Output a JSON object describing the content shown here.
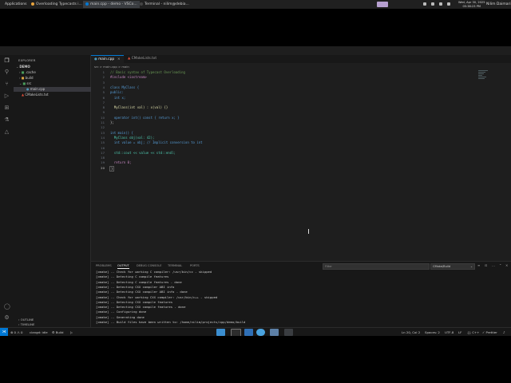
{
  "topbar": {
    "applications_label": "Applications",
    "tasks": [
      {
        "label": "Overloading Typecasts i...",
        "active": false,
        "dot_color": "#e8a33d"
      },
      {
        "label": "main.cpp - demo - VSCo...",
        "active": true,
        "dot_color": "#0078d4"
      },
      {
        "label": "Terminal - nilim@debia...",
        "active": false,
        "dot_color": "#444444"
      }
    ],
    "clock_date": "Wed, Apr 30, 2025",
    "clock_time": "05:38:23 PM",
    "user": "Nilim Daimari"
  },
  "activity": {
    "icons": [
      "files-icon",
      "search-icon",
      "source-control-icon",
      "run-debug-icon",
      "extensions-icon",
      "testing-icon",
      "cmake-icon"
    ],
    "bottom_icons": [
      "account-icon",
      "settings-icon"
    ]
  },
  "sidebar": {
    "title": "EXPLORER",
    "root": "DEMO",
    "items": [
      {
        "label": ".cache",
        "kind": "folder",
        "depth": 1,
        "expanded": false
      },
      {
        "label": "build",
        "kind": "folder",
        "depth": 1,
        "expanded": false
      },
      {
        "label": "src",
        "kind": "folder",
        "depth": 1,
        "expanded": true
      },
      {
        "label": "main.cpp",
        "kind": "file",
        "depth": 2,
        "selected": true
      },
      {
        "label": "CMakeLists.txt",
        "kind": "file",
        "depth": 1,
        "selected": false
      }
    ],
    "outline": "OUTLINE",
    "timeline": "TIMELINE"
  },
  "tabs": [
    {
      "label": "main.cpp",
      "active": true
    },
    {
      "label": "CMakeLists.txt",
      "active": false
    }
  ],
  "breadcrumb": "src > main.cpp > main",
  "editor": {
    "line_numbers": [
      "1",
      "2",
      "3",
      "4",
      "5",
      "6",
      "7",
      "8",
      "9",
      "10",
      "11",
      "12",
      "13",
      "14",
      "15",
      "16",
      "17",
      "18",
      "19",
      "20"
    ],
    "lines": [
      "// Basic syntax of Typecast Overloading",
      "#include <iostream>",
      "",
      "class MyClass {",
      "public:",
      "  int x;",
      "",
      "  MyClass(int val) : x(val) {}",
      "",
      "  operator int() const { return x; }",
      "};",
      "",
      "int main() {",
      "  MyClass obj(val: 42);",
      "  int value = obj; // Implicit conversion to int",
      "",
      "  std::cout << value << std::endl;",
      "",
      "  return 0;",
      "}"
    ]
  },
  "panel": {
    "tabs": [
      "PROBLEMS",
      "OUTPUT",
      "DEBUG CONSOLE",
      "TERMINAL",
      "PORTS"
    ],
    "active_tab": "OUTPUT",
    "filter_placeholder": "Filter",
    "channel": "CMake/Build",
    "output": [
      "[cmake] -- Check for working C compiler: /usr/bin/cc - skipped",
      "[cmake] -- Detecting C compile features",
      "[cmake] -- Detecting C compile features - done",
      "[cmake] -- Detecting CXX compiler ABI info",
      "[cmake] -- Detecting CXX compiler ABI info - done",
      "[cmake] -- Check for working CXX compiler: /usr/bin/c++ - skipped",
      "[cmake] -- Detecting CXX compile features",
      "[cmake] -- Detecting CXX compile features - done",
      "[cmake] -- Configuring done",
      "[cmake] -- Generating done",
      "[cmake] -- Build files have been written to: /home/nilim/projects/cpp/demo/build"
    ]
  },
  "statusbar": {
    "errors": "0",
    "warnings": "0",
    "compiler": "clangd: idle",
    "build": "Build",
    "position": "Ln 20, Col 2",
    "spaces": "Spaces: 2",
    "encoding": "UTF-8",
    "eol": "LF",
    "language": "C++",
    "formatter": "Prettier"
  },
  "colors": {
    "accent": "#0078d4",
    "editor_bg": "#1e1e1e",
    "sidebar_bg": "#181818"
  }
}
